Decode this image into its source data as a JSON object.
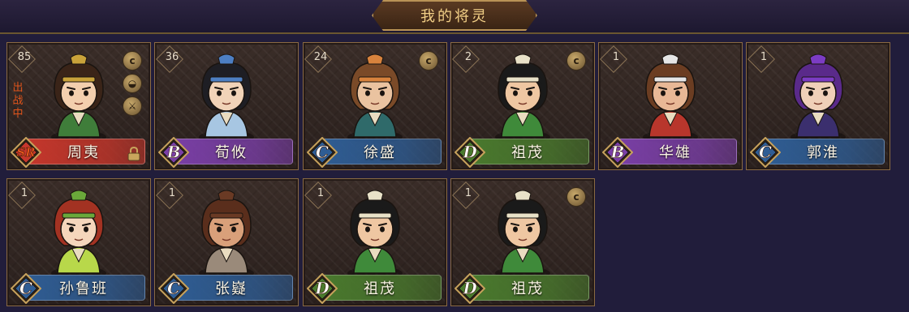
{
  "title": "我的将灵",
  "colors": {
    "SR": "#c6372c",
    "B": "#7a3fa6",
    "C": "#2f5d94",
    "D": "#4a7a2e"
  },
  "cards": [
    {
      "level": "85",
      "name": "周夷",
      "grade": "SR",
      "status": "出战中",
      "locked": true,
      "side_icons": [
        "coin-icon",
        "bowl-icon",
        "sword-icon"
      ]
    },
    {
      "level": "36",
      "name": "荀攸",
      "grade": "B",
      "status": "",
      "locked": false,
      "side_icons": []
    },
    {
      "level": "24",
      "name": "徐盛",
      "grade": "C",
      "status": "",
      "locked": false,
      "side_icons": [
        "coin-icon"
      ]
    },
    {
      "level": "2",
      "name": "祖茂",
      "grade": "D",
      "status": "",
      "locked": false,
      "side_icons": [
        "coin-icon"
      ]
    },
    {
      "level": "1",
      "name": "华雄",
      "grade": "B",
      "status": "",
      "locked": false,
      "side_icons": []
    },
    {
      "level": "1",
      "name": "郭淮",
      "grade": "C",
      "status": "",
      "locked": false,
      "side_icons": []
    },
    {
      "level": "1",
      "name": "孙鲁班",
      "grade": "C",
      "status": "",
      "locked": false,
      "side_icons": []
    },
    {
      "level": "1",
      "name": "张嶷",
      "grade": "C",
      "status": "",
      "locked": false,
      "side_icons": []
    },
    {
      "level": "1",
      "name": "祖茂",
      "grade": "D",
      "status": "",
      "locked": false,
      "side_icons": []
    },
    {
      "level": "1",
      "name": "祖茂",
      "grade": "D",
      "status": "",
      "locked": false,
      "side_icons": [
        "coin-icon"
      ]
    }
  ]
}
